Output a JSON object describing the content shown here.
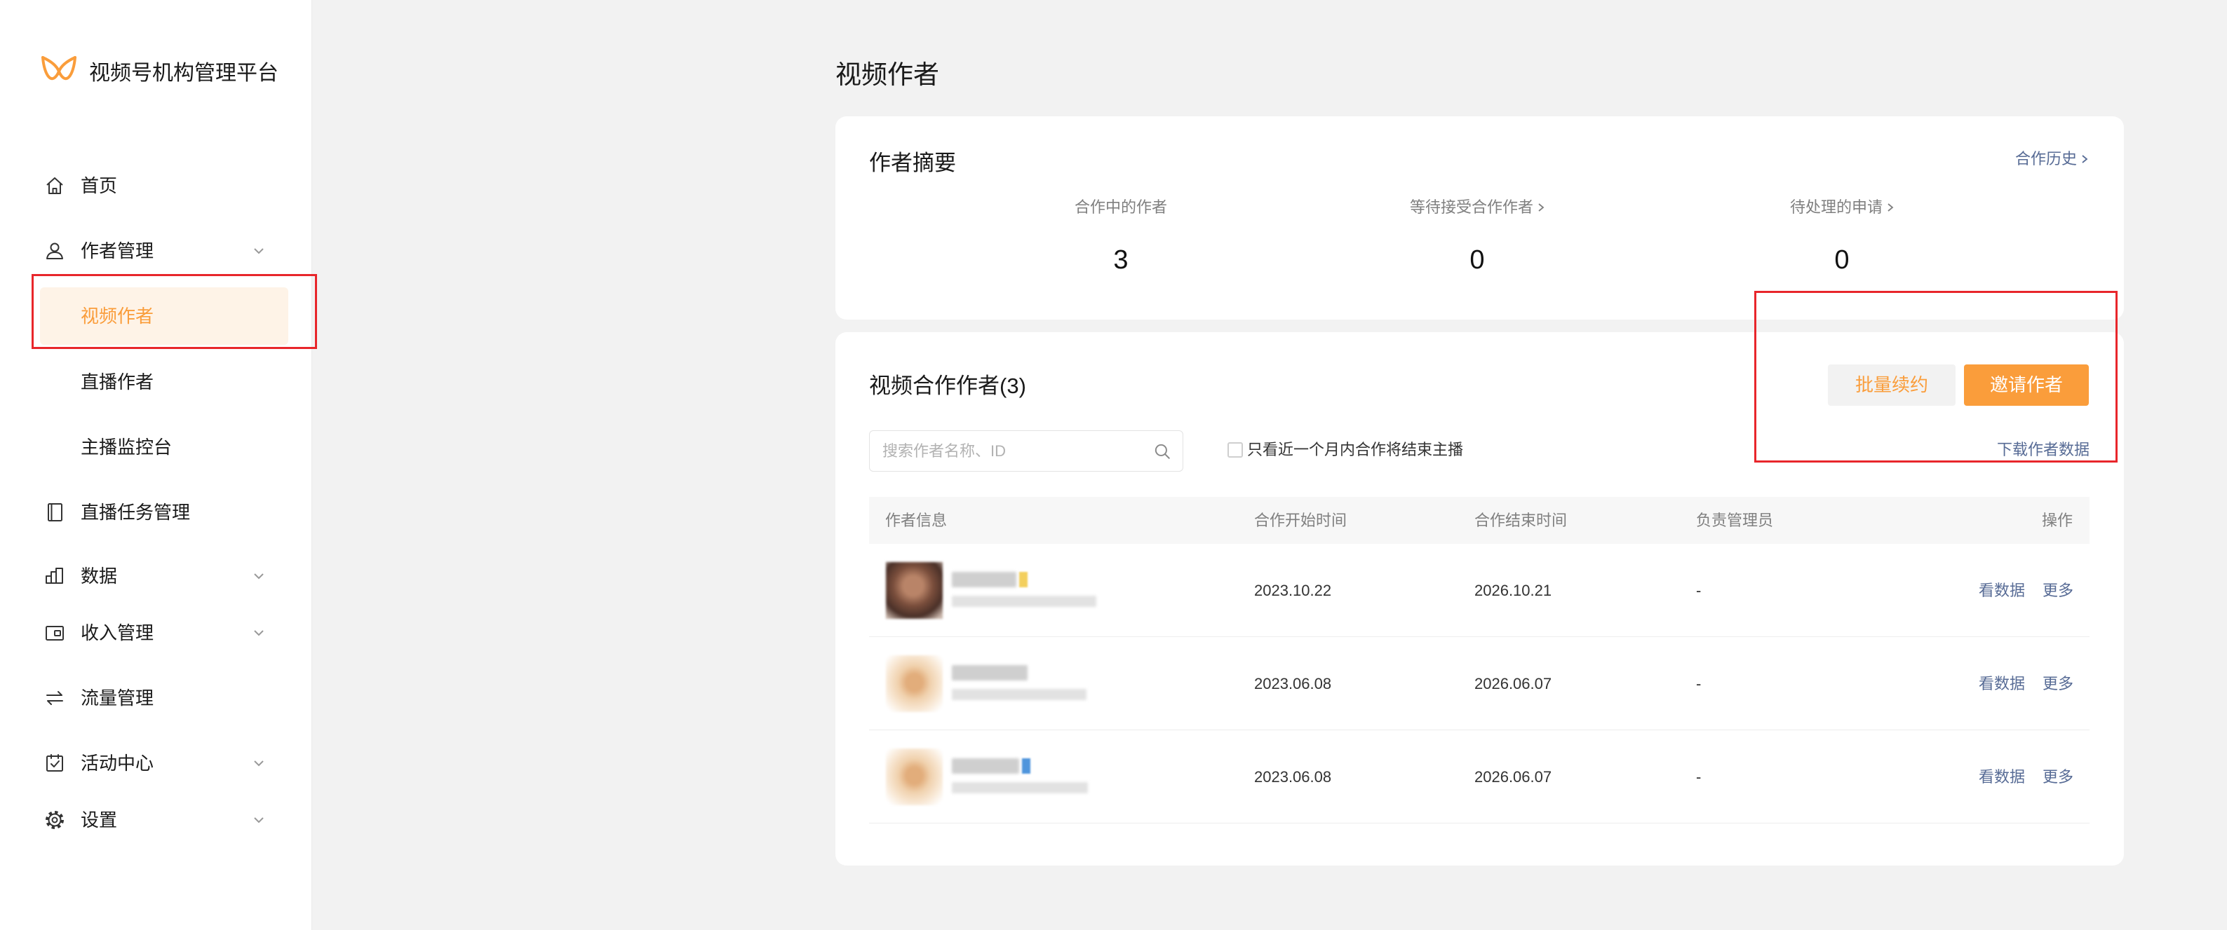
{
  "app": {
    "title": "视频号机构管理平台",
    "logo_icon": "butterfly-logo-icon"
  },
  "colors": {
    "accent": "#fa9d3b",
    "accent_bg": "#fef3e7",
    "link": "#576b95",
    "annotation_red": "#e8262b",
    "page_bg": "#f2f2f2"
  },
  "sidebar": {
    "items": [
      {
        "label": "首页",
        "icon": "home-icon"
      },
      {
        "label": "作者管理",
        "icon": "user-icon",
        "expandable": true,
        "expanded": true
      },
      {
        "label": "视频作者",
        "sub": true,
        "active": true
      },
      {
        "label": "直播作者",
        "sub": true
      },
      {
        "label": "主播监控台",
        "sub": true
      },
      {
        "label": "直播任务管理",
        "icon": "book-icon"
      },
      {
        "label": "数据",
        "icon": "bar-chart-icon",
        "expandable": true
      },
      {
        "label": "收入管理",
        "icon": "wallet-icon",
        "expandable": true
      },
      {
        "label": "流量管理",
        "icon": "swap-arrows-icon"
      },
      {
        "label": "活动中心",
        "icon": "calendar-check-icon",
        "expandable": true
      },
      {
        "label": "设置",
        "icon": "gear-icon",
        "expandable": true
      }
    ]
  },
  "page": {
    "title": "视频作者"
  },
  "summary": {
    "title": "作者摘要",
    "history_link": "合作历史",
    "stats": [
      {
        "label": "合作中的作者",
        "value": "3",
        "has_arrow": false
      },
      {
        "label": "等待接受合作作者",
        "value": "0",
        "has_arrow": true
      },
      {
        "label": "待处理的申请",
        "value": "0",
        "has_arrow": true
      }
    ]
  },
  "partners": {
    "title": "视频合作作者(3)",
    "buttons": {
      "batch_renew": "批量续约",
      "invite": "邀请作者"
    },
    "search": {
      "placeholder": "搜索作者名称、ID",
      "value": ""
    },
    "filter_label": "只看近一个月内合作将结束主播",
    "filter_checked": false,
    "download_link": "下载作者数据",
    "columns": [
      "作者信息",
      "合作开始时间",
      "合作结束时间",
      "负责管理员",
      "操作"
    ],
    "rows": [
      {
        "start": "2023.10.22",
        "end": "2026.10.21",
        "admin": "-",
        "actions": [
          "看数据",
          "更多"
        ]
      },
      {
        "start": "2023.06.08",
        "end": "2026.06.07",
        "admin": "-",
        "actions": [
          "看数据",
          "更多"
        ]
      },
      {
        "start": "2023.06.08",
        "end": "2026.06.07",
        "admin": "-",
        "actions": [
          "看数据",
          "更多"
        ]
      }
    ]
  }
}
